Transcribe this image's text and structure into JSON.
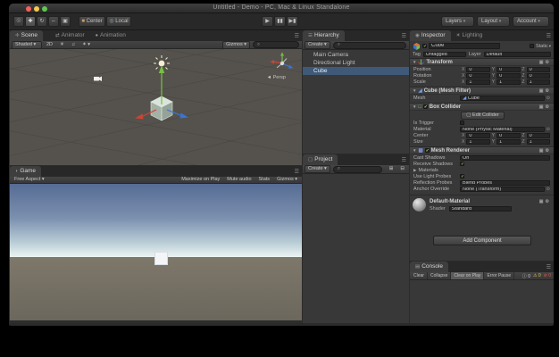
{
  "window": {
    "title": "Untitled - Demo - PC, Mac & Linux Standalone"
  },
  "toolbar": {
    "pivot": "Center",
    "space": "Local",
    "dropdowns": [
      "Layers",
      "Layout",
      "Account"
    ]
  },
  "scene": {
    "tabs": [
      "Scene",
      "Animator",
      "Animation"
    ],
    "shading": "Shaded",
    "toggle_2d": "2D",
    "gizmos": "Gizmos",
    "persp": "Persp"
  },
  "game": {
    "tab": "Game",
    "aspect": "Free Aspect",
    "maximize": "Maximize on Play",
    "mute": "Mute audio",
    "stats": "Stats",
    "gizmos": "Gizmos"
  },
  "hierarchy": {
    "tab": "Hierarchy",
    "create": "Create",
    "items": [
      {
        "label": "Main Camera",
        "selected": false
      },
      {
        "label": "Directional Light",
        "selected": false
      },
      {
        "label": "Cube",
        "selected": true
      }
    ]
  },
  "project": {
    "tab": "Project",
    "create": "Create"
  },
  "inspector": {
    "tabs": [
      "Inspector",
      "Lighting"
    ],
    "object": {
      "name": "Cube",
      "static_label": "Static",
      "tag_label": "Tag",
      "tag": "Untagged",
      "layer_label": "Layer",
      "layer": "Default"
    },
    "axes": {
      "x": "X",
      "y": "Y",
      "z": "Z"
    },
    "transform": {
      "title": "Transform",
      "rows": [
        {
          "label": "Position",
          "x": "0",
          "y": "0",
          "z": "0"
        },
        {
          "label": "Rotation",
          "x": "0",
          "y": "0",
          "z": "0"
        },
        {
          "label": "Scale",
          "x": "1",
          "y": "1",
          "z": "1"
        }
      ]
    },
    "mesh_filter": {
      "title": "Cube (Mesh Filter)",
      "mesh_label": "Mesh",
      "mesh": "Cube"
    },
    "box_collider": {
      "title": "Box Collider",
      "edit": "Edit Collider",
      "is_trigger": "Is Trigger",
      "material_label": "Material",
      "material": "None (Physic Material)",
      "center": {
        "label": "Center",
        "x": "0",
        "y": "0",
        "z": "0"
      },
      "size": {
        "label": "Size",
        "x": "1",
        "y": "1",
        "z": "1"
      }
    },
    "mesh_renderer": {
      "title": "Mesh Renderer",
      "cast_label": "Cast Shadows",
      "cast": "On",
      "receive": "Receive Shadows",
      "materials": "Materials",
      "probes_label": "Use Light Probes",
      "reflection_label": "Reflection Probes",
      "reflection": "Blend Probes",
      "anchor_label": "Anchor Override",
      "anchor": "None (Transform)"
    },
    "material": {
      "name": "Default-Material",
      "shader_label": "Shader",
      "shader": "Standard"
    },
    "add_component": "Add Component"
  },
  "console": {
    "tab": "Console",
    "clear": "Clear",
    "collapse": "Collapse",
    "clear_on_play": "Clear on Play",
    "error_pause": "Error Pause",
    "info_count": "0",
    "warn_count": "0",
    "error_count": "0"
  },
  "colors": {
    "selection": "#3f5a78",
    "sky_top": "#566b93",
    "ground": "#7a7467",
    "axis_red": "#cc4434",
    "axis_green": "#77c043",
    "axis_blue": "#3a74d6",
    "traffic_red": "#f4605a",
    "traffic_yellow": "#f7c94f",
    "traffic_green": "#62c554"
  }
}
